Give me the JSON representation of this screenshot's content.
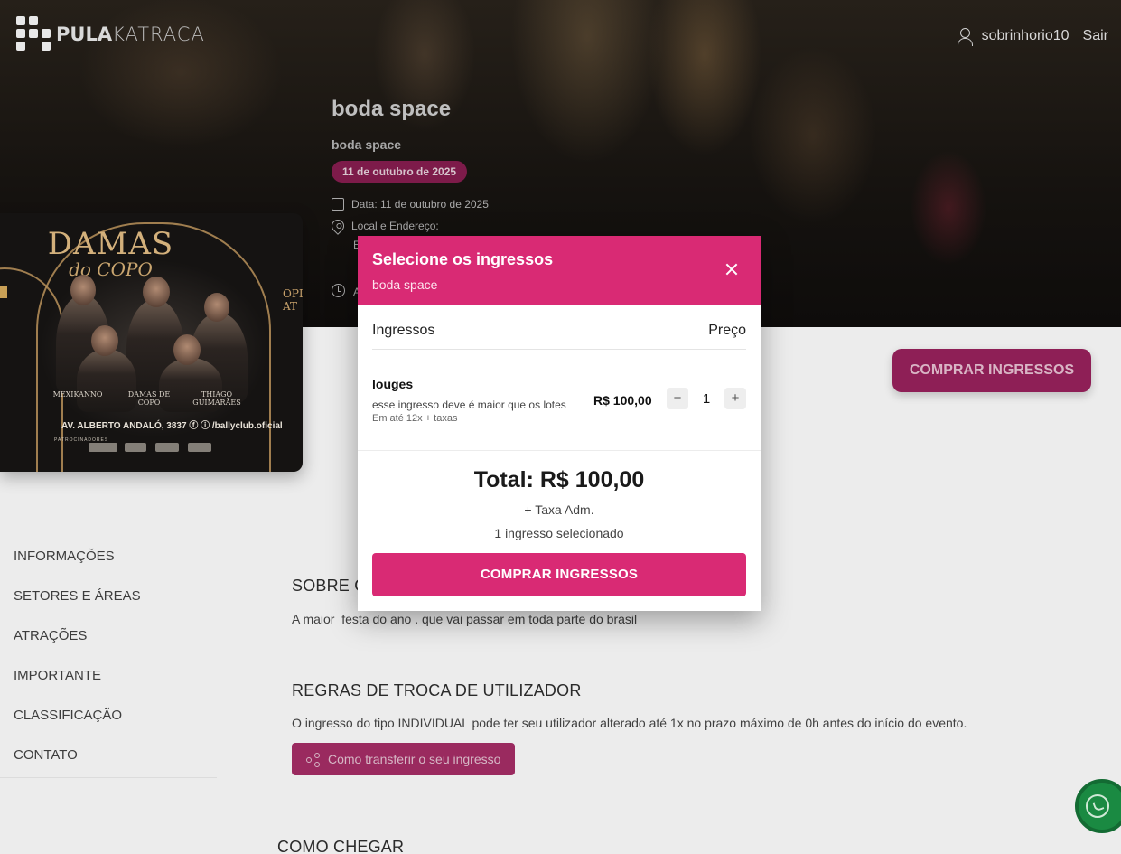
{
  "header": {
    "logo_text_bold": "PULA",
    "logo_text_light": "KATRACA",
    "username": "sobrinhorio10",
    "logout_label": "Sair"
  },
  "event": {
    "title": "boda space",
    "subtitle": "boda space",
    "date_pill": "11 de outubro de 2025",
    "date_line": "Data: 11 de outubro de 2025",
    "location_label": "Local e Endereço:",
    "address_fragment": "E",
    "time_fragment": "A"
  },
  "poster": {
    "title": "DAMAS",
    "subtitle": "do COPO",
    "names": [
      "MEXIKANNO",
      "DAMAS DE COPO",
      "THIAGO GUIMARÃES"
    ],
    "address": "AV. ALBERTO ANDALÓ, 3837 ⓕ ⓘ /ballyclub.oficial",
    "side_text": "OPI AT",
    "sponsors_label": "PATROCINADORES"
  },
  "page_buy_label": "COMPRAR INGRESSOS",
  "menu": {
    "items": [
      {
        "label": "INFORMAÇÕES"
      },
      {
        "label": "SETORES E ÁREAS"
      },
      {
        "label": "ATRAÇÕES"
      },
      {
        "label": "IMPORTANTE"
      },
      {
        "label": "CLASSIFICAÇÃO"
      },
      {
        "label": "CONTATO"
      }
    ]
  },
  "sections": {
    "about_title": "SOBRE O",
    "about_text": "A maior  festa do ano . que vai passar em toda parte do brasil",
    "rules_title": "REGRAS DE TROCA DE UTILIZADOR",
    "rules_text": "O ingresso do tipo INDIVIDUAL pode ter seu utilizador alterado até 1x no prazo máximo de 0h antes do início do evento.",
    "transfer_label": "Como transferir o seu ingresso",
    "directions_title": "COMO CHEGAR"
  },
  "modal": {
    "title": "Selecione os ingressos",
    "subtitle": "boda space",
    "col_tickets": "Ingressos",
    "col_price": "Preço",
    "ticket": {
      "name": "louges",
      "description": "esse ingresso deve é maior que os lotes",
      "installments": "Em até 12x + taxas",
      "price": "R$ 100,00",
      "quantity": "1",
      "minus": "−",
      "plus": "+"
    },
    "total": "Total: R$ 100,00",
    "fee": "+ Taxa Adm.",
    "selected_count": "1 ingresso selecionado",
    "buy_label": "COMPRAR INGRESSOS"
  },
  "colors": {
    "accent": "#d92a74",
    "accent_dim": "#8e1f56",
    "whatsapp": "#1a8a42"
  }
}
